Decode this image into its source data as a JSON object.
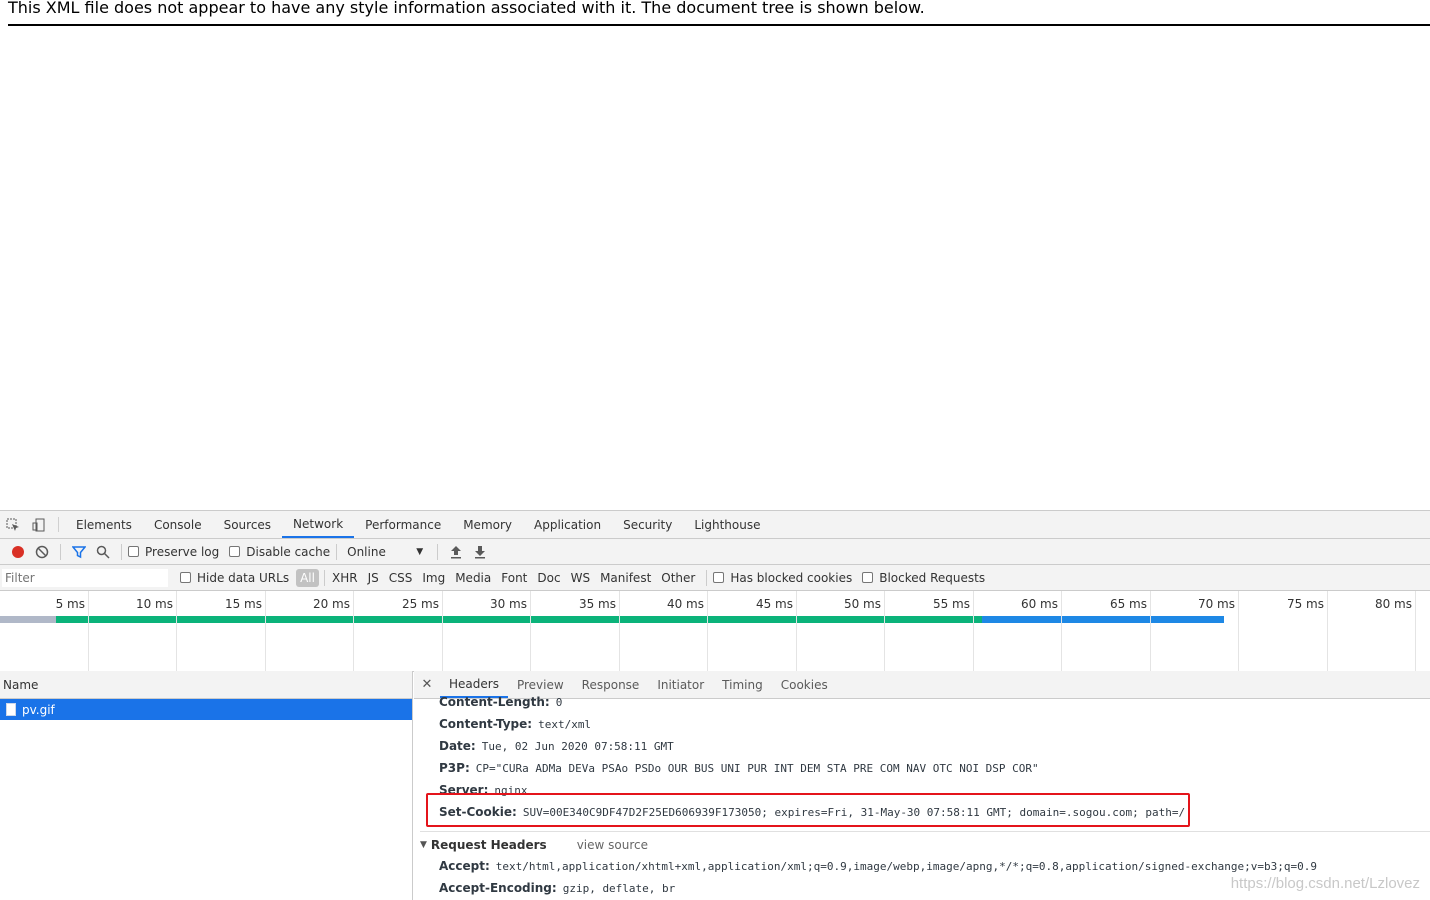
{
  "xml_notice": "This XML file does not appear to have any style information associated with it. The document tree is shown below.",
  "devtools": {
    "main_tabs": [
      "Elements",
      "Console",
      "Sources",
      "Network",
      "Performance",
      "Memory",
      "Application",
      "Security",
      "Lighthouse"
    ],
    "active_main_tab": "Network",
    "toolbar": {
      "preserve_log": "Preserve log",
      "disable_cache": "Disable cache",
      "throttle": "Online"
    },
    "filterbar": {
      "filter_placeholder": "Filter",
      "hide_data_urls": "Hide data URLs",
      "types": [
        "All",
        "XHR",
        "JS",
        "CSS",
        "Img",
        "Media",
        "Font",
        "Doc",
        "WS",
        "Manifest",
        "Other"
      ],
      "has_blocked_cookies": "Has blocked cookies",
      "blocked_requests": "Blocked Requests"
    },
    "timeline": {
      "ticks": [
        "5 ms",
        "10 ms",
        "15 ms",
        "20 ms",
        "25 ms",
        "30 ms",
        "35 ms",
        "40 ms",
        "45 ms",
        "50 ms",
        "55 ms",
        "60 ms",
        "65 ms",
        "70 ms",
        "75 ms",
        "80 ms"
      ]
    },
    "name_pane": {
      "header": "Name",
      "rows": [
        "pv.gif"
      ]
    },
    "detail_tabs": [
      "Headers",
      "Preview",
      "Response",
      "Initiator",
      "Timing",
      "Cookies"
    ],
    "response_headers": [
      {
        "key": "Content-Length:",
        "value": "0"
      },
      {
        "key": "Content-Type:",
        "value": "text/xml"
      },
      {
        "key": "Date:",
        "value": "Tue, 02 Jun 2020 07:58:11 GMT"
      },
      {
        "key": "P3P:",
        "value": "CP=\"CURa ADMa DEVa PSAo PSDo OUR BUS UNI PUR INT DEM STA PRE COM NAV OTC NOI DSP COR\""
      },
      {
        "key": "Server:",
        "value": "nginx"
      },
      {
        "key": "Set-Cookie:",
        "value": "SUV=00E340C9DF47D2F25ED606939F173050; expires=Fri, 31-May-30 07:58:11 GMT; domain=.sogou.com; path=/"
      }
    ],
    "request_headers": {
      "title": "Request Headers",
      "view_source": "view source",
      "items": [
        {
          "key": "Accept:",
          "value": "text/html,application/xhtml+xml,application/xml;q=0.9,image/webp,image/apng,*/*;q=0.8,application/signed-exchange;v=b3;q=0.9"
        },
        {
          "key": "Accept-Encoding:",
          "value": "gzip, deflate, br"
        }
      ]
    }
  },
  "watermark": "https://blog.csdn.net/Lzlovez"
}
